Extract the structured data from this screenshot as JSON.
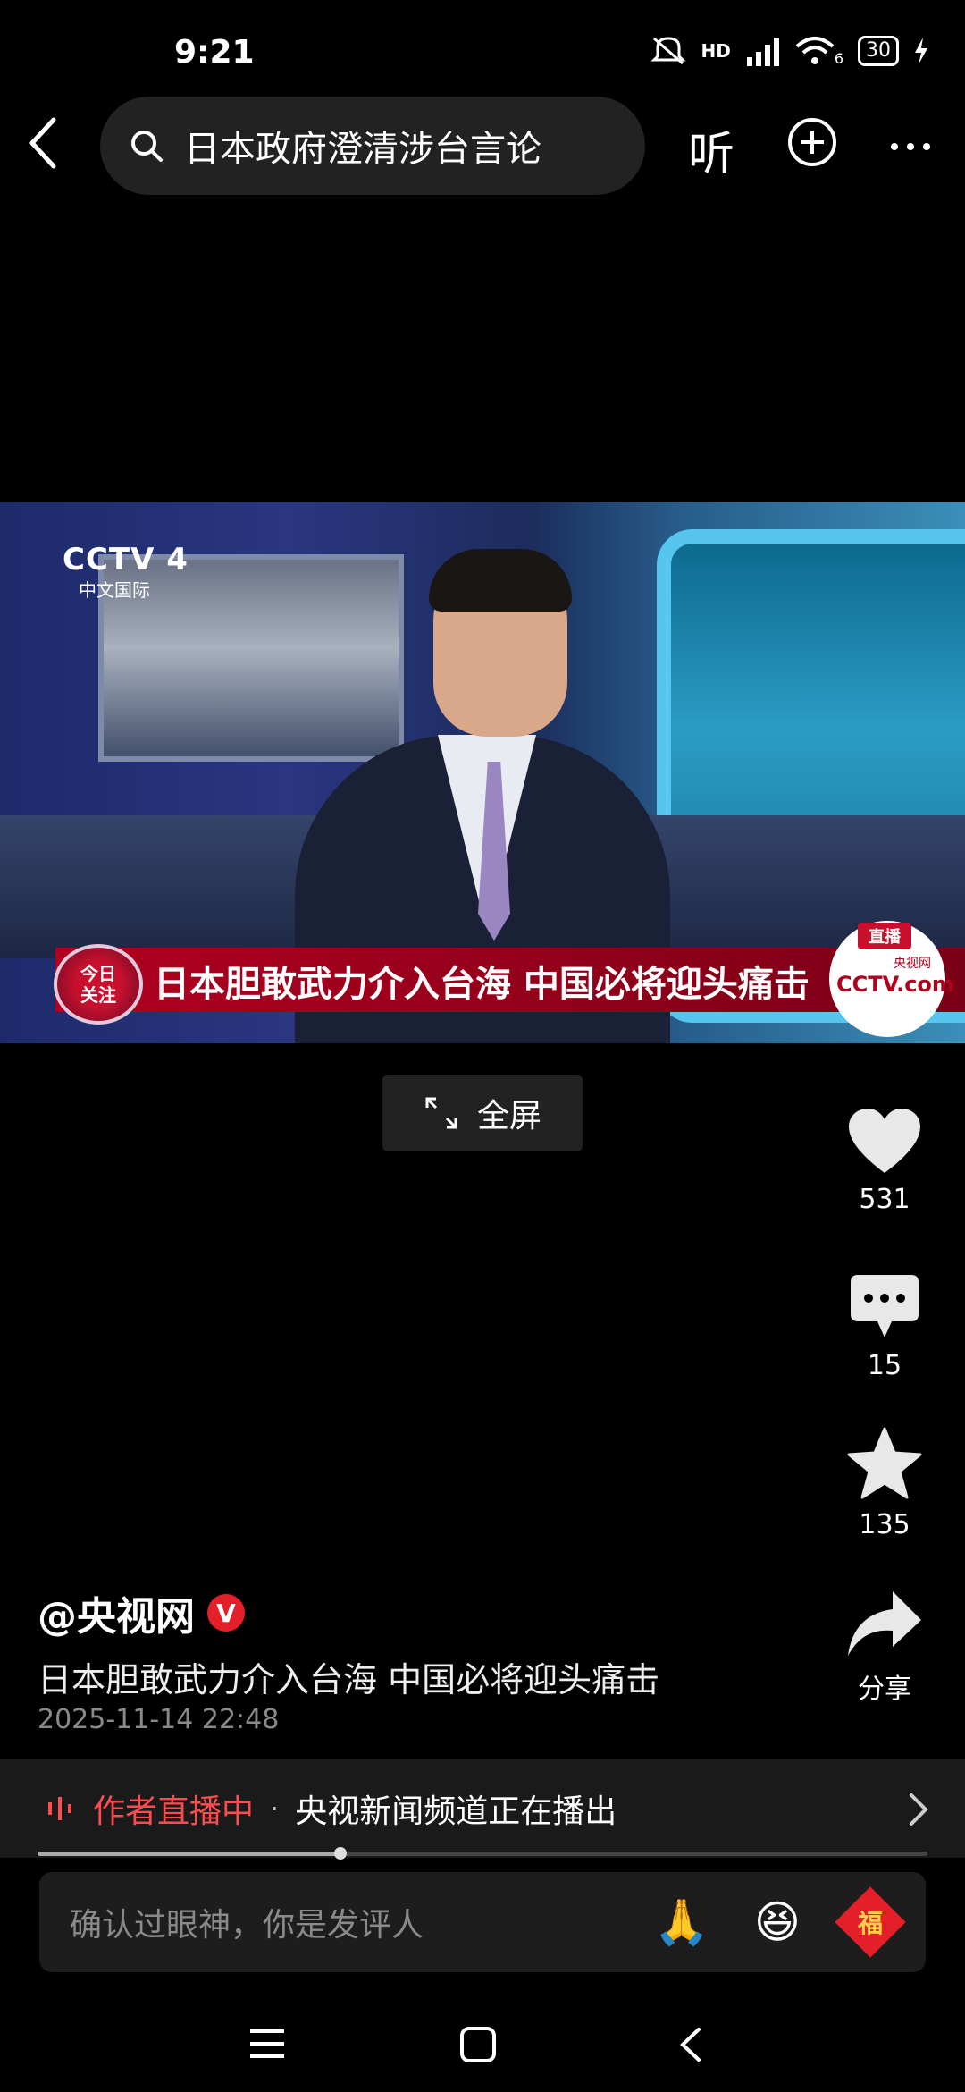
{
  "status_bar": {
    "time": "9:21",
    "network": "HD",
    "wifi_sub": "6",
    "battery": "30"
  },
  "top_nav": {
    "search_text": "日本政府澄清涉台言论",
    "listen_label": "听"
  },
  "video": {
    "channel_logo": "CCTV 4",
    "channel_sub": "中文国际",
    "program_badge_line1": "今日",
    "program_badge_line2": "关注",
    "headline": "日本胆敢武力介入台海 中国必将迎头痛击",
    "live_tag": "直播",
    "live_logo": "CCTV.com",
    "live_logo_sub": "央视网"
  },
  "fullscreen_label": "全屏",
  "actions": {
    "likes": "531",
    "comments": "15",
    "favorites": "135",
    "share_label": "分享"
  },
  "post": {
    "author": "@央视网",
    "verified_mark": "V",
    "description": "日本胆敢武力介入台海 中国必将迎头痛击",
    "timestamp": "2025-11-14 22:48"
  },
  "live_bar": {
    "label": "作者直播中",
    "separator": "·",
    "text": "央视新闻频道正在播出"
  },
  "progress": {
    "fraction": 0.34
  },
  "comment_bar": {
    "placeholder": "确认过眼神，你是发评人",
    "emoji_pray": "🙏",
    "emoji_laugh": "😆",
    "fu_char": "福"
  },
  "colors": {
    "accent_red": "#e3202a",
    "live_red": "#ff4d4f"
  }
}
